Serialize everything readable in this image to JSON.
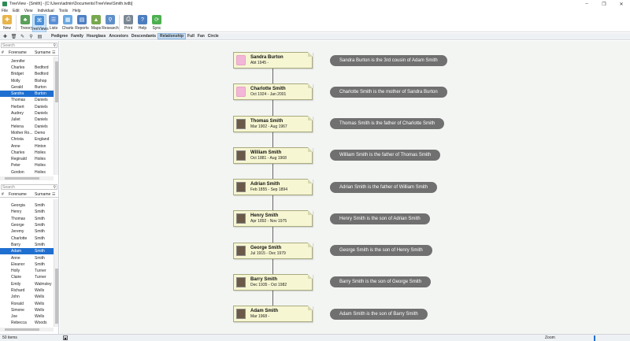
{
  "window": {
    "title": "TreeView - [Smith] - [C:\\Users\\admin\\Documents\\TreeView\\Smith.tvdb]",
    "min": "–",
    "max": "❐",
    "close": "✕"
  },
  "menu": [
    "File",
    "Edit",
    "View",
    "Individual",
    "Tools",
    "Help"
  ],
  "ribbon": [
    {
      "label": "New",
      "icon": "new-icon",
      "color": "#e9b44c"
    },
    {
      "label": "Trees",
      "icon": "trees-icon",
      "color": "#5aa05a"
    },
    {
      "label": "TreeViews",
      "icon": "treeviews-icon",
      "color": "#4a90d9"
    },
    {
      "label": "Lists",
      "icon": "lists-icon",
      "color": "#5b8fd6"
    },
    {
      "label": "Charts",
      "icon": "charts-icon",
      "color": "#6aa8e0"
    },
    {
      "label": "Reports",
      "icon": "reports-icon",
      "color": "#4d7fc4"
    },
    {
      "label": "Maps",
      "icon": "maps-icon",
      "color": "#77a84e"
    },
    {
      "label": "Research",
      "icon": "research-icon",
      "color": "#5f8fc8"
    },
    {
      "label": "Print",
      "icon": "print-icon",
      "color": "#7a8794"
    },
    {
      "label": "Help",
      "icon": "help-icon",
      "color": "#4c7ebf"
    },
    {
      "label": "Sync",
      "icon": "sync-icon",
      "color": "#4caf50"
    }
  ],
  "view_tabs": [
    "Pedigree",
    "Family",
    "Hourglass",
    "Ancestors",
    "Descendants",
    "Relationship",
    "Full",
    "Fan",
    "Circle"
  ],
  "active_view_tab": "Relationship",
  "left": {
    "search_placeholder": "Search",
    "col_num": "#",
    "col_forename": "Forename",
    "col_surname": "Surname",
    "list1": [
      [
        "Jennifer",
        ""
      ],
      [
        "Charles",
        "Bedford"
      ],
      [
        "Bridget",
        "Bedford"
      ],
      [
        "Molly",
        "Bishop"
      ],
      [
        "Gerald",
        "Burton"
      ],
      [
        "Sandra",
        "Burton"
      ],
      [
        "Thomas",
        "Daniels"
      ],
      [
        "Herbert",
        "Daniels"
      ],
      [
        "Audrey",
        "Daniels"
      ],
      [
        "Juliet",
        "Daniels"
      ],
      [
        "Helena",
        "Daniels"
      ],
      [
        "Mother Ro...",
        "Demo"
      ],
      [
        "Christa",
        "England"
      ],
      [
        "Anne",
        "Hinton"
      ],
      [
        "Charles",
        "Hoiles"
      ],
      [
        "Reginald",
        "Hoiles"
      ],
      [
        "Peter",
        "Hoiles"
      ],
      [
        "Gordon",
        "Hoiles"
      ]
    ],
    "list1_selected": 5,
    "list2": [
      [
        "Georgia",
        "Smith"
      ],
      [
        "Henry",
        "Smith"
      ],
      [
        "Thomas",
        "Smith"
      ],
      [
        "George",
        "Smith"
      ],
      [
        "Jeremy",
        "Smith"
      ],
      [
        "Charlotte",
        "Smith"
      ],
      [
        "Barry",
        "Smith"
      ],
      [
        "Adam",
        "Smith"
      ],
      [
        "Anne",
        "Smith"
      ],
      [
        "Eleanor",
        "Smith"
      ],
      [
        "Holly",
        "Turner"
      ],
      [
        "Claire",
        "Turner"
      ],
      [
        "Emily",
        "Walmsley"
      ],
      [
        "Richard",
        "Wells"
      ],
      [
        "John",
        "Wells"
      ],
      [
        "Ronald",
        "Wells"
      ],
      [
        "Simone",
        "Wells"
      ],
      [
        "Joe",
        "Wells"
      ],
      [
        "Rebecca",
        "Woods"
      ]
    ],
    "list2_selected": 7
  },
  "people": [
    {
      "name": "Sandra Burton",
      "dates": "Abt 1945 -",
      "female": true,
      "relation": "Sandra Burton is the 3rd cousin of Adam Smith"
    },
    {
      "name": "Charlotte Smith",
      "dates": "Oct 1924 - Jan 2001",
      "female": true,
      "relation": "Charlotte Smith is the mother of Sandra Burton"
    },
    {
      "name": "Thomas Smith",
      "dates": "Mar 1902 - Aug 1967",
      "female": false,
      "relation": "Thomas Smith is the father of Charlotte Smith"
    },
    {
      "name": "William Smith",
      "dates": "Oct 1881 - Aug 1968",
      "female": false,
      "relation": "William Smith is the father of Thomas Smith"
    },
    {
      "name": "Adrian Smith",
      "dates": "Feb 1855 - Sep 1894",
      "female": false,
      "relation": "Adrian Smith is the father of William Smith"
    },
    {
      "name": "Henry Smith",
      "dates": "Apr 1892 - Nov 1975",
      "female": false,
      "relation": "Henry Smith is the son of Adrian Smith"
    },
    {
      "name": "George Smith",
      "dates": "Jul 1915 - Dec 1979",
      "female": false,
      "relation": "George Smith is the son of Henry Smith"
    },
    {
      "name": "Barry Smith",
      "dates": "Dec 1935 - Oct 1982",
      "female": false,
      "relation": "Barry Smith is the son of George Smith"
    },
    {
      "name": "Adam Smith",
      "dates": "Mar 1968 -",
      "female": false,
      "relation": "Adam Smith is the son of Barry Smith"
    }
  ],
  "status": {
    "count": "50 items",
    "zoom": "Zoom"
  }
}
